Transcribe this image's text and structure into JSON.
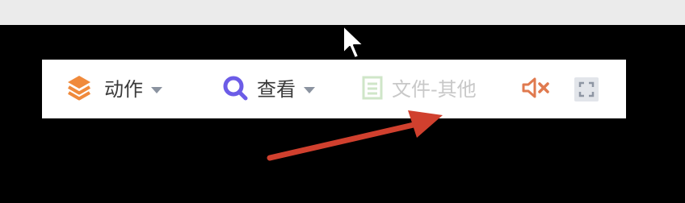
{
  "toolbar": {
    "action_label": "动作",
    "view_label": "查看",
    "file_label": "文件-其他"
  },
  "icons": {
    "action": "layers-icon",
    "view": "search-icon",
    "file": "document-icon",
    "mute": "speaker-muted-icon",
    "fullscreen": "fullscreen-icon",
    "cursor": "mouse-pointer-icon",
    "annotation": "red-arrow-annotation"
  },
  "colors": {
    "action_icon": "#f08a3c",
    "view_icon": "#6c5ce7",
    "file_icon": "#cfe6c8",
    "mute_icon": "#e07a4f",
    "annotation_arrow": "#d0402e",
    "disabled_text": "#c8c8c8"
  }
}
